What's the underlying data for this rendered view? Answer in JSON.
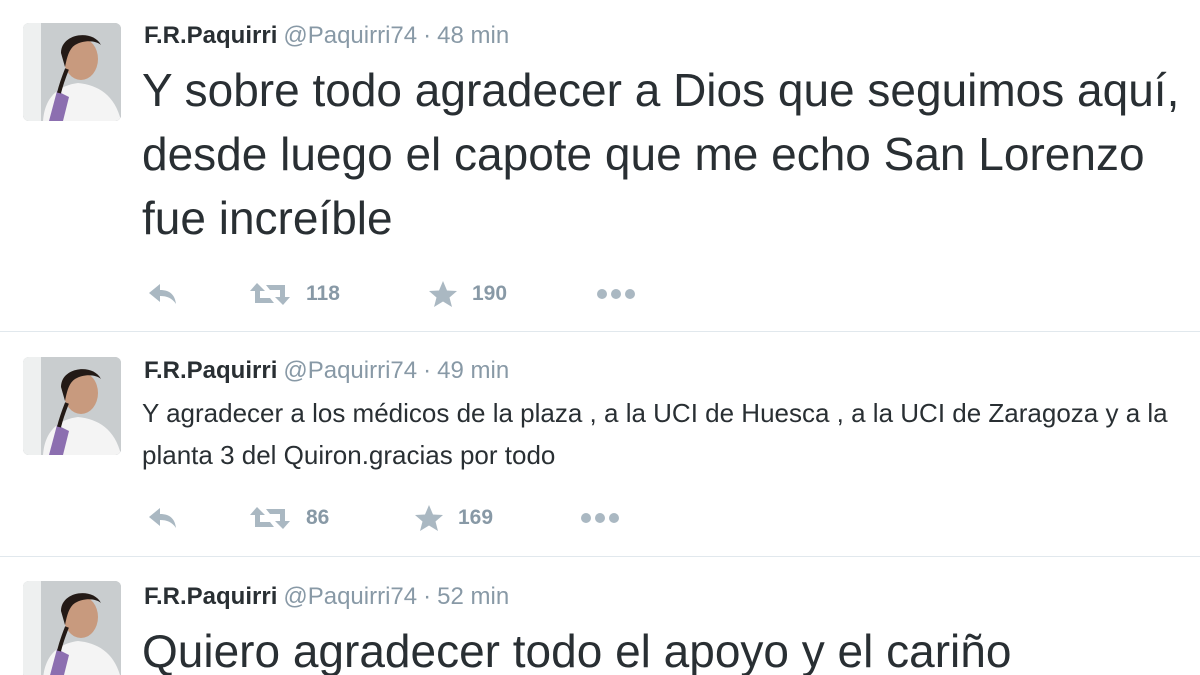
{
  "tweets": [
    {
      "fullname": "F.R.Paquirri",
      "screenname": "@Paquirri74",
      "separator": "·",
      "time": "48 min",
      "text": "Y sobre todo agradecer a Dios que seguimos aquí, desde luego el capote que me echo San Lorenzo fue increíble",
      "retweets": "118",
      "favorites": "190",
      "icons": [
        "reply-icon",
        "retweet-icon",
        "star-icon",
        "more-icon"
      ]
    },
    {
      "fullname": "F.R.Paquirri",
      "screenname": "@Paquirri74",
      "separator": "·",
      "time": "49 min",
      "text": "Y agradecer a los médicos de la plaza , a la UCI de Huesca , a la UCI de Zaragoza y a la planta 3 del Quiron.gracias por todo",
      "retweets": "86",
      "favorites": "169",
      "icons": [
        "reply-icon",
        "retweet-icon",
        "star-icon",
        "more-icon"
      ]
    },
    {
      "fullname": "F.R.Paquirri",
      "screenname": "@Paquirri74",
      "separator": "·",
      "time": "52 min",
      "text": "Quiero agradecer todo el apoyo y el cariño"
    }
  ],
  "colors": {
    "text": "#292f33",
    "muted": "#8899a6",
    "icon": "#aab8c2",
    "divider": "#e1e8ed"
  }
}
